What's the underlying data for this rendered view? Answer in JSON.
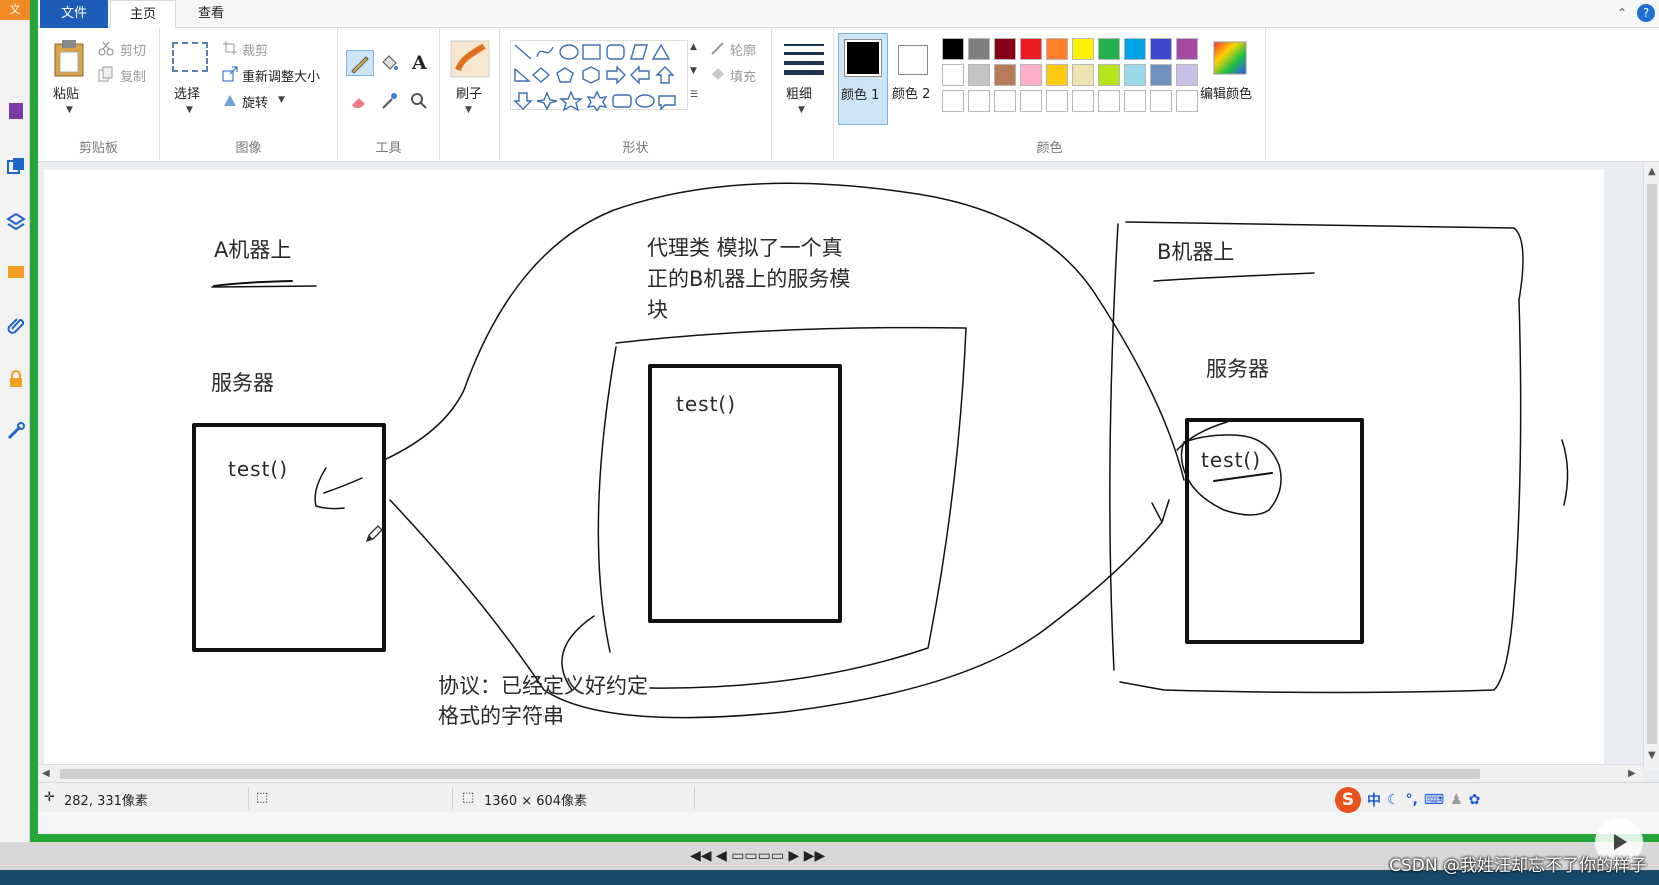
{
  "app": {
    "tabs": {
      "file": "文件",
      "home": "主页",
      "view": "查看"
    }
  },
  "ribbon": {
    "clipboard": {
      "paste": "粘贴",
      "cut": "剪切",
      "copy": "复制",
      "label": "剪贴板"
    },
    "image": {
      "select": "选择",
      "crop": "裁剪",
      "resize": "重新调整大小",
      "rotate": "旋转",
      "label": "图像"
    },
    "tools": {
      "label": "工具",
      "text_tool": "A"
    },
    "brush": {
      "label": "刷子"
    },
    "shapes": {
      "label": "形状",
      "outline": "轮廓",
      "fill": "填充"
    },
    "size": {
      "label": "粗细"
    },
    "colors": {
      "color1": "颜色 1",
      "color2": "颜色 2",
      "edit": "编辑颜色",
      "label": "颜色",
      "row1": [
        "#000000",
        "#7f7f7f",
        "#880015",
        "#ed1c24",
        "#ff7f27",
        "#fff200",
        "#22b14c",
        "#00a2e8",
        "#3f48cc",
        "#a349a4"
      ],
      "row2": [
        "#ffffff",
        "#c3c3c3",
        "#b97a57",
        "#ffaec9",
        "#ffc90e",
        "#efe4b0",
        "#b5e61d",
        "#99d9ea",
        "#7092be",
        "#c8bfe7"
      ],
      "row3": [
        "#ffffff",
        "#ffffff",
        "#ffffff",
        "#ffffff",
        "#ffffff",
        "#ffffff",
        "#ffffff",
        "#ffffff",
        "#ffffff",
        "#ffffff"
      ],
      "primary": "#000000",
      "secondary": "#ffffff"
    }
  },
  "canvas": {
    "machine_a_label": "A机器上",
    "server_a": "服务器",
    "test_a": "test()",
    "proxy_line1": "代理类   模拟了一个真",
    "proxy_line2": "正的B机器上的服务模",
    "proxy_line3": "块",
    "test_proxy": "test()",
    "machine_b_label": "B机器上",
    "server_b": "服务器",
    "test_b": "test()",
    "protocol_line1": "协议：已经定义好约定",
    "protocol_line2": "格式的字符串"
  },
  "status": {
    "cursor_pos": "282, 331像素",
    "canvas_size": "1360 × 604像素"
  },
  "ime": {
    "zhong": "中"
  },
  "watermark": "CSDN @我姓汪却忘不了你的样子"
}
